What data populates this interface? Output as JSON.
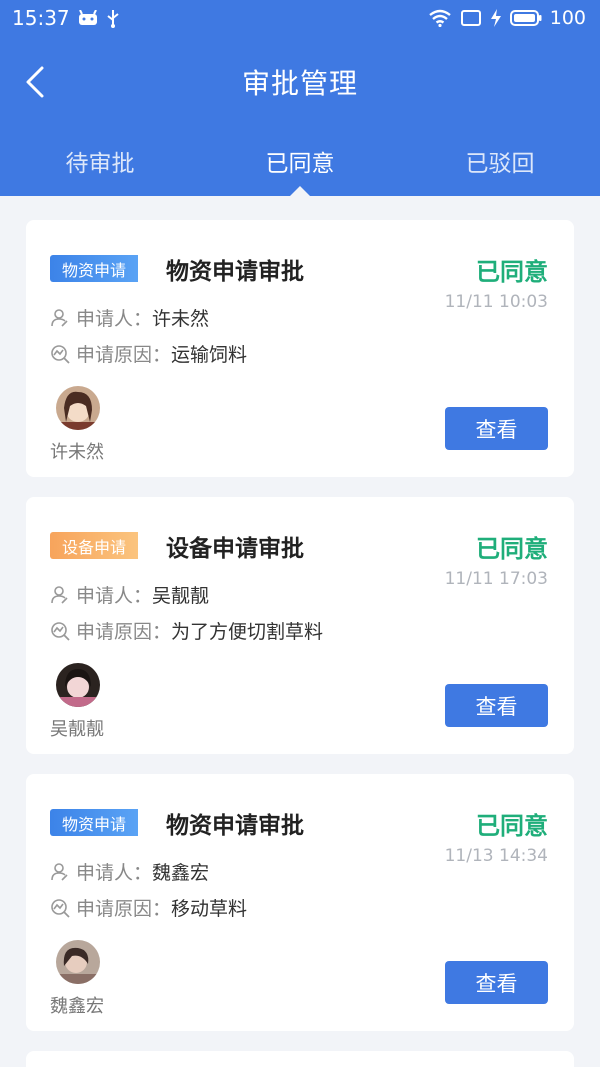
{
  "statusbar": {
    "time": "15:37",
    "battery": "100",
    "icons": [
      "android-icon",
      "usb-icon",
      "wifi-icon",
      "screen-icon",
      "charging-icon",
      "battery-icon"
    ]
  },
  "header": {
    "title": "审批管理",
    "tabs": [
      {
        "label": "待审批",
        "active": false
      },
      {
        "label": "已同意",
        "active": true
      },
      {
        "label": "已驳回",
        "active": false
      }
    ]
  },
  "cards": [
    {
      "badge": "物资申请",
      "badge_color": "#3c83e8",
      "title": "物资申请审批",
      "status": "已同意",
      "time": "11/11 10:03",
      "applicant_label": "申请人：",
      "applicant": "许未然",
      "reason_label": "申请原因：",
      "reason": "运输饲料",
      "avatar_name": "许未然",
      "button": "查看"
    },
    {
      "badge": "设备申请",
      "badge_color": "#f7a45c",
      "title": "设备申请审批",
      "status": "已同意",
      "time": "11/11 17:03",
      "applicant_label": "申请人：",
      "applicant": "吴靓靓",
      "reason_label": "申请原因：",
      "reason": "为了方便切割草料",
      "avatar_name": "吴靓靓",
      "button": "查看"
    },
    {
      "badge": "物资申请",
      "badge_color": "#3c83e8",
      "title": "物资申请审批",
      "status": "已同意",
      "time": "11/13 14:34",
      "applicant_label": "申请人：",
      "applicant": "魏鑫宏",
      "reason_label": "申请原因：",
      "reason": "移动草料",
      "avatar_name": "魏鑫宏",
      "button": "查看"
    }
  ],
  "colors": {
    "primary": "#3f79e2",
    "approved": "#1fae7a",
    "background": "#f2f4f8"
  }
}
